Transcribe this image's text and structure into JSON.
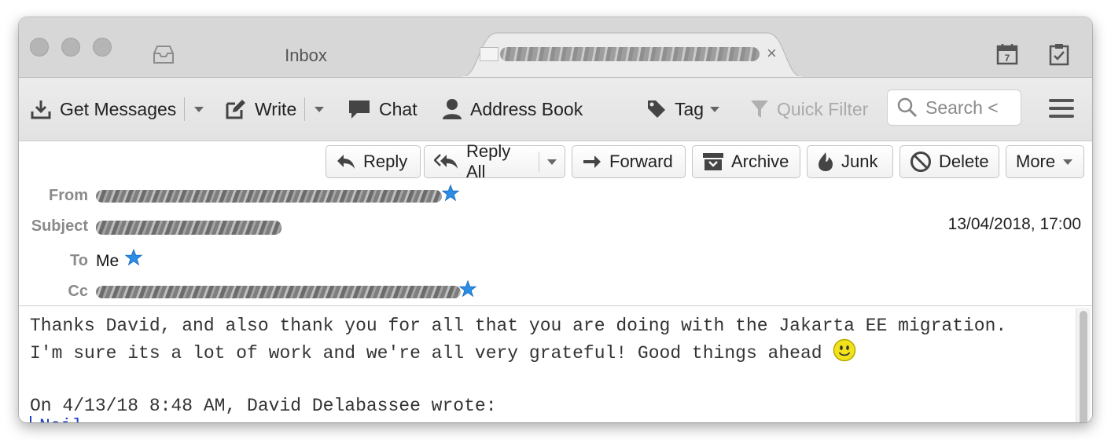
{
  "tabs": {
    "inbox_label": "Inbox",
    "active_close": "×"
  },
  "toolbar": {
    "get_messages": "Get Messages",
    "write": "Write",
    "chat": "Chat",
    "address_book": "Address Book",
    "tag": "Tag",
    "quick_filter": "Quick Filter",
    "search_placeholder": "Search < "
  },
  "message_actions": {
    "reply": "Reply",
    "reply_all": "Reply All",
    "forward": "Forward",
    "archive": "Archive",
    "junk": "Junk",
    "delete": "Delete",
    "more": "More"
  },
  "header": {
    "from_label": "From",
    "subject_label": "Subject",
    "to_label": "To",
    "cc_label": "Cc",
    "to_value": "Me",
    "date": "13/04/2018, 17:00"
  },
  "body": {
    "line1": "Thanks David, and also thank you for all that you are doing with the Jakarta EE migration.",
    "line2": "I'm sure its a lot of work and we're all very grateful! Good things ahead ",
    "line3": "",
    "line4": "On 4/13/18 8:48 AM, David Delabassee wrote:",
    "quote_start": "Neil,"
  },
  "colors": {
    "star": "#2b8de6",
    "quote": "#1f3fc7",
    "toolbar_bg": "#e6e6e6"
  }
}
